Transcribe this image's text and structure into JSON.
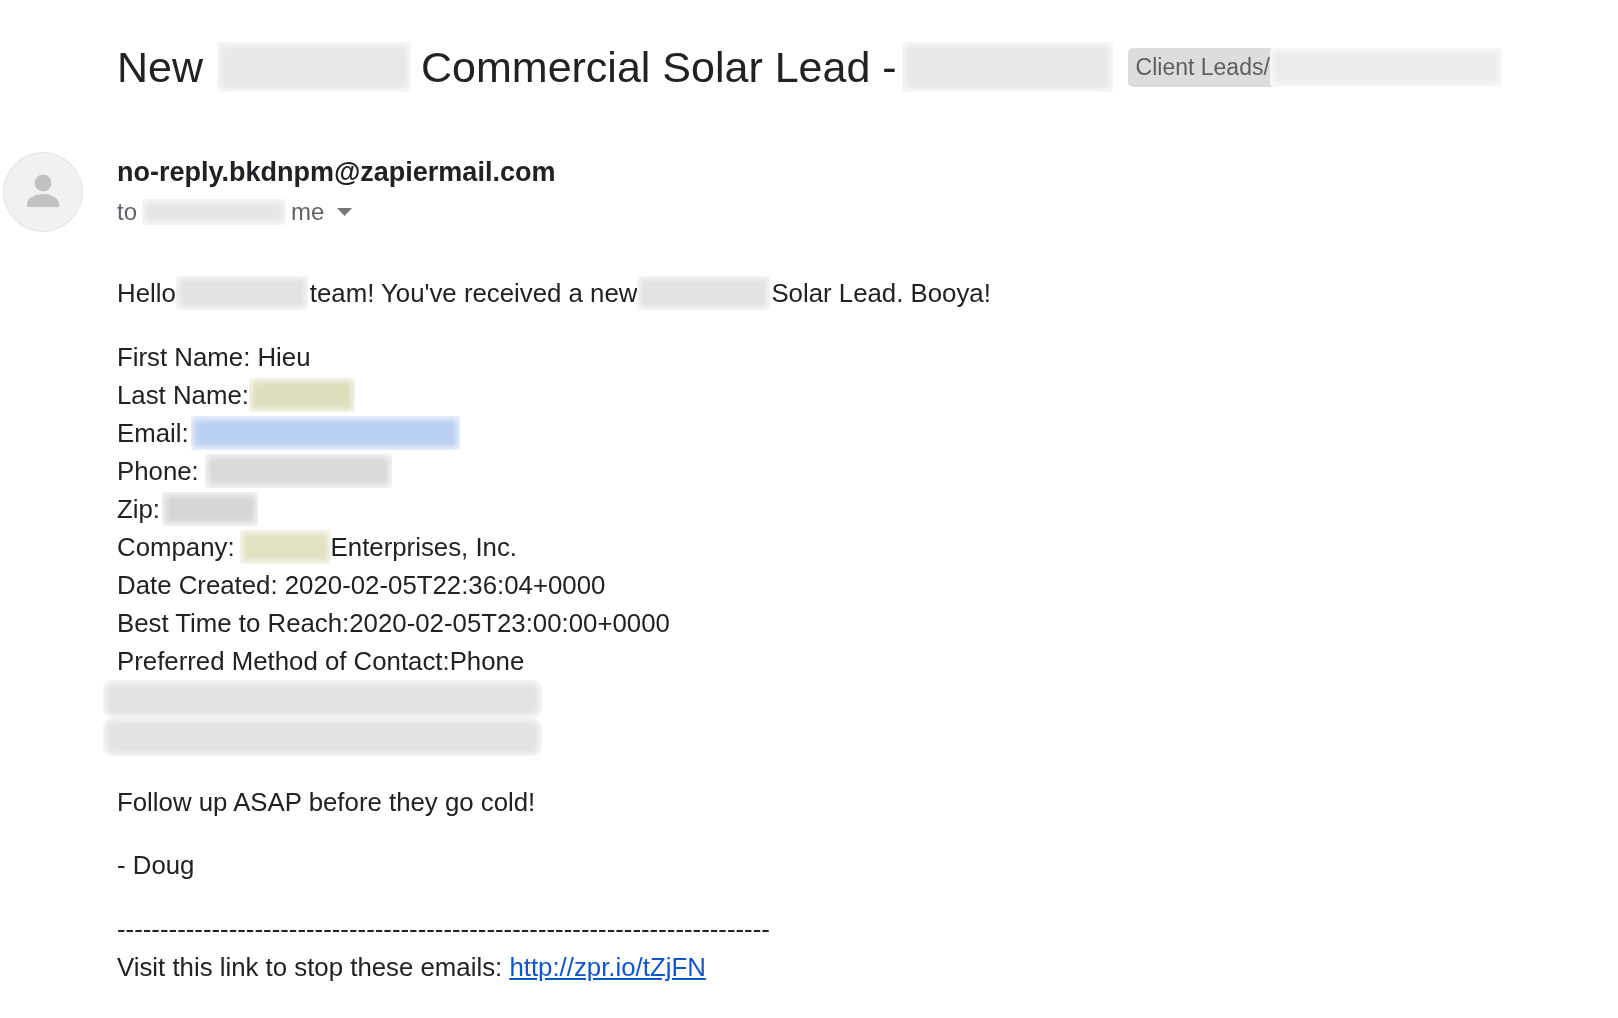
{
  "subject": {
    "parts": [
      {
        "kind": "text",
        "text": "New"
      },
      {
        "kind": "blur",
        "color": "#e8e8e8"
      },
      {
        "kind": "text",
        "text": "Commercial Solar Lead -"
      },
      {
        "kind": "blur",
        "color": "#e8e8e8"
      }
    ],
    "label": {
      "text": "Client Leads/",
      "redaction": {
        "color": "#ececec"
      }
    }
  },
  "sender": {
    "email": "no-reply.bkdnpm@zapiermail.com",
    "to": {
      "parts": [
        {
          "kind": "text",
          "text": "to"
        },
        {
          "kind": "blur",
          "color": "#e6e6e6"
        },
        {
          "kind": "text",
          "text": "me"
        }
      ]
    }
  },
  "body": {
    "greeting": {
      "parts": [
        {
          "kind": "text",
          "text": "Hello"
        },
        {
          "kind": "blur",
          "color": "#e2e2e2"
        },
        {
          "kind": "text",
          "text": "team! You've received a new"
        },
        {
          "kind": "blur",
          "color": "#e2e2e2"
        },
        {
          "kind": "text",
          "text": "Solar Lead. Booya!"
        }
      ]
    },
    "fields": [
      {
        "parts": [
          {
            "kind": "text",
            "text": "First Name: Hieu"
          }
        ]
      },
      {
        "parts": [
          {
            "kind": "text",
            "text": "Last Name:"
          },
          {
            "kind": "blur",
            "color": "#deddbd"
          }
        ]
      },
      {
        "parts": [
          {
            "kind": "text",
            "text": "Email:"
          },
          {
            "kind": "blur",
            "color": "#b9cff2"
          }
        ]
      },
      {
        "parts": [
          {
            "kind": "text",
            "text": "Phone:"
          },
          {
            "kind": "blur",
            "color": "#d9d9d9"
          }
        ]
      },
      {
        "parts": [
          {
            "kind": "text",
            "text": "Zip:"
          },
          {
            "kind": "blur",
            "color": "#d6d6d6"
          }
        ]
      },
      {
        "parts": [
          {
            "kind": "text",
            "text": "Company:"
          },
          {
            "kind": "blur",
            "color": "#e2e1c2"
          },
          {
            "kind": "text",
            "text": "Enterprises, Inc."
          }
        ]
      },
      {
        "parts": [
          {
            "kind": "text",
            "text": "Date Created: 2020-02-05T22:36:04+0000"
          }
        ]
      },
      {
        "parts": [
          {
            "kind": "text",
            "text": "Best Time to Reach:2020-02-05T23:00:00+0000"
          }
        ]
      },
      {
        "parts": [
          {
            "kind": "text",
            "text": "Preferred Method of Contact:Phone"
          }
        ]
      },
      {
        "parts": [
          {
            "kind": "blur",
            "color": "#e3e3e3"
          }
        ]
      },
      {
        "parts": [
          {
            "kind": "blur",
            "color": "#e3e3e3"
          }
        ]
      }
    ],
    "closing": "Follow up ASAP before they go cold!",
    "signature": "- Doug",
    "divider": "----------------------------------------------------------------------------",
    "footer": {
      "text": "Visit this link to stop these emails:",
      "link": "http://zpr.io/tZjFN"
    }
  }
}
